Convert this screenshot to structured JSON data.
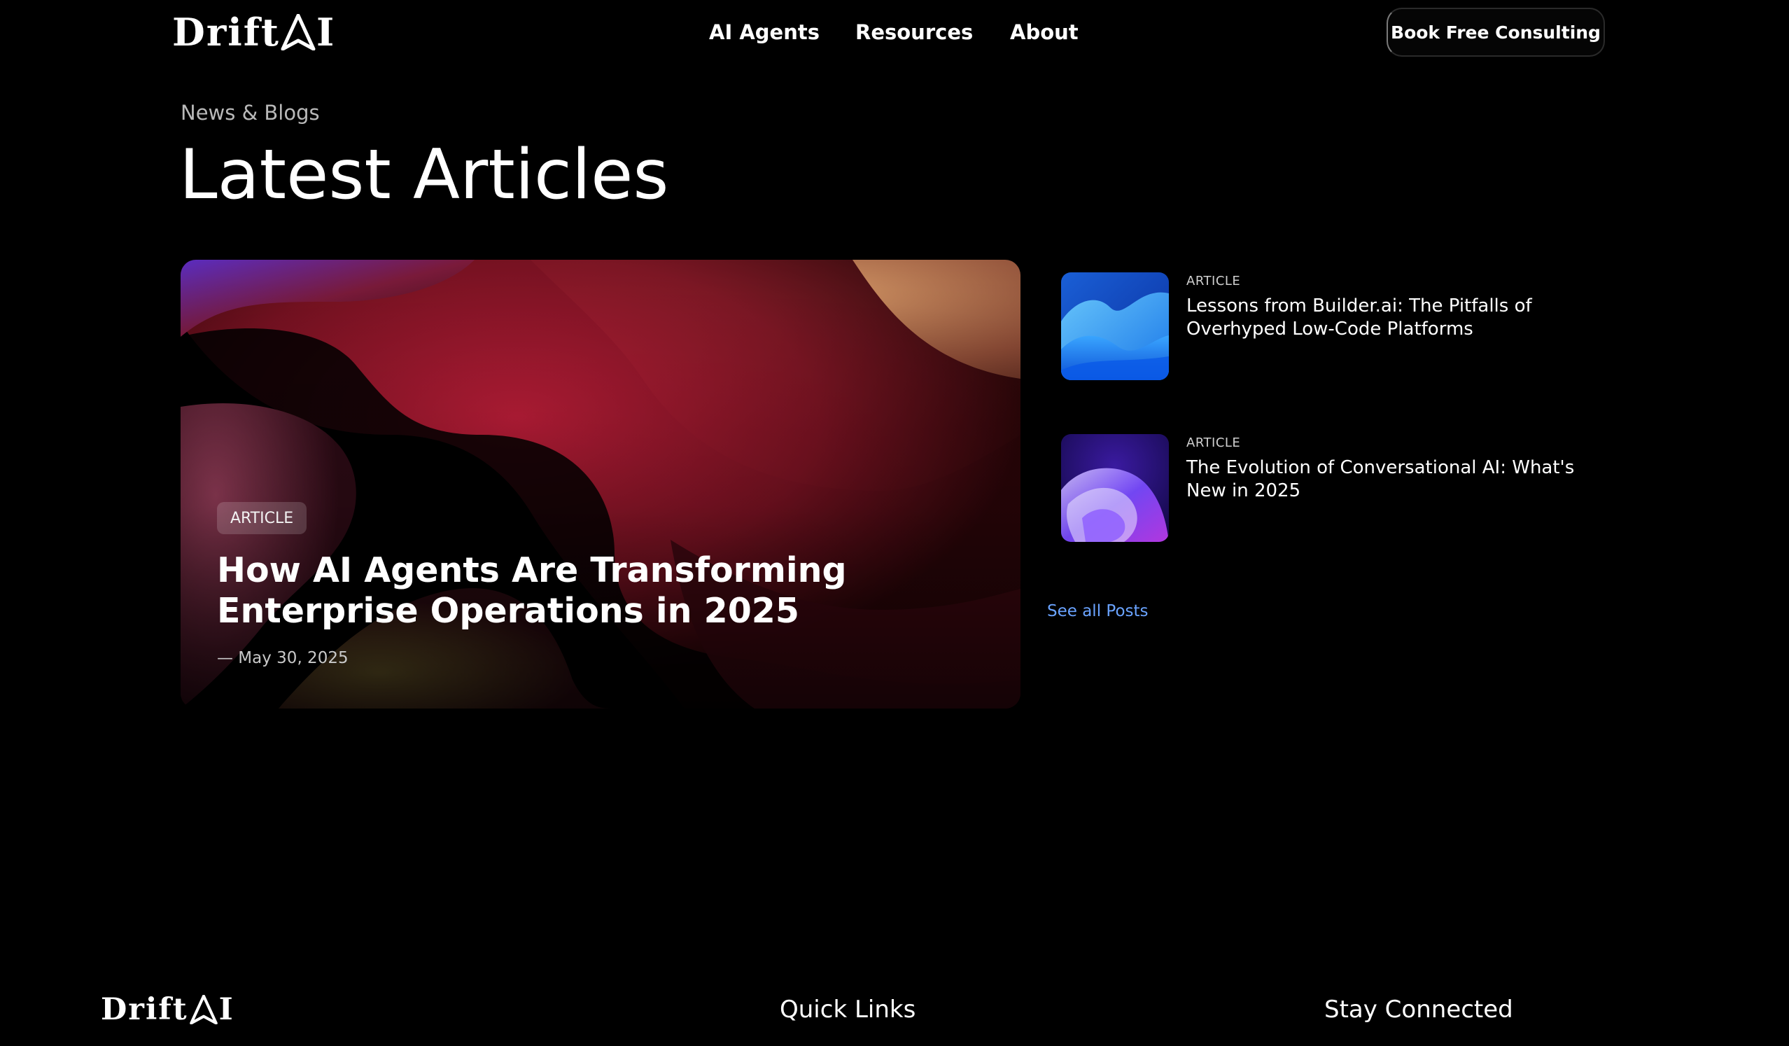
{
  "brand": {
    "name_prefix": "Drift",
    "name_suffix": "I",
    "logo_mark_icon": "compass-a-icon"
  },
  "nav": {
    "items": [
      {
        "label": "AI Agents"
      },
      {
        "label": "Resources"
      },
      {
        "label": "About"
      }
    ]
  },
  "header": {
    "cta_label": "Book Free Consulting"
  },
  "section": {
    "eyebrow": "News & Blogs",
    "title": "Latest Articles"
  },
  "featured": {
    "badge": "ARTICLE",
    "title": "How AI Agents Are Transforming Enterprise Operations in 2025",
    "date": "— May 30, 2025",
    "image": "abstract-gradient-waves-image"
  },
  "side_articles": [
    {
      "kicker": "ARTICLE",
      "title": "Lessons from Builder.ai: The Pitfalls of Overhyped Low-Code Platforms",
      "image": "blue-wave-thumbnail"
    },
    {
      "kicker": "ARTICLE",
      "title": "The Evolution of Conversational AI: What's New in 2025",
      "image": "purple-swirl-thumbnail"
    }
  ],
  "see_all_label": "See all Posts",
  "footer": {
    "quick_links_heading": "Quick Links",
    "stay_connected_heading": "Stay Connected"
  },
  "colors": {
    "background": "#000000",
    "text": "#ffffff",
    "muted_text": "#b9b9b9",
    "link_accent": "#6aa3ff"
  }
}
